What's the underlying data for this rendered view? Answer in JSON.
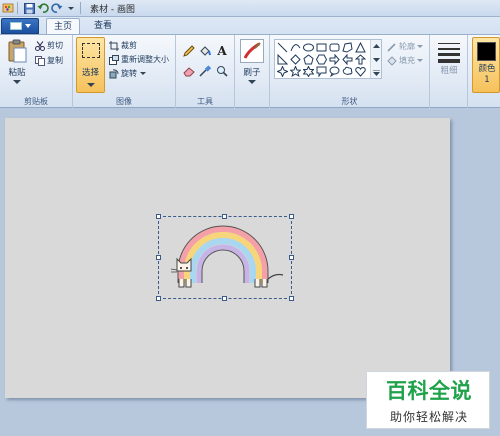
{
  "window": {
    "title": "素材 - 画图"
  },
  "tabs": {
    "home": "主页",
    "view": "查看"
  },
  "clipboard": {
    "paste": "粘贴",
    "cut": "剪切",
    "copy": "复制",
    "group": "剪贴板"
  },
  "image": {
    "select": "选择",
    "crop": "裁剪",
    "resize": "重新调整大小",
    "rotate": "旋转",
    "group": "图像"
  },
  "tools": {
    "group": "工具"
  },
  "brushes": {
    "label": "刷子"
  },
  "shapes": {
    "outline": "轮廓",
    "fill": "填充",
    "group": "形状"
  },
  "size": {
    "label": "粗细"
  },
  "color1": {
    "label": "颜色 1",
    "value": "#000000"
  },
  "watermark": {
    "title": "百科全说",
    "subtitle": "助你轻松解决"
  },
  "colors": {
    "accent_orange": "#f6c15b",
    "ribbon_bg": "#dfe8f4",
    "canvas_bg": "#d9d9d9"
  }
}
